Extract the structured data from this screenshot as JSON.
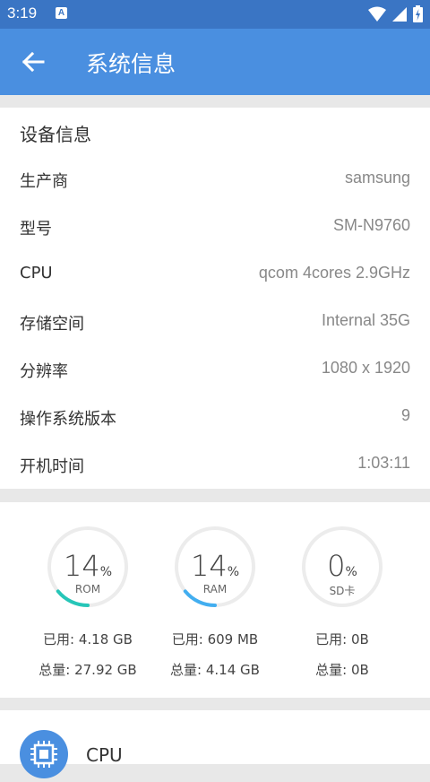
{
  "status_bar": {
    "time": "3:19",
    "notification_icon": "A"
  },
  "app_bar": {
    "title": "系统信息",
    "back_icon": "arrow-left-icon"
  },
  "device_info": {
    "title": "设备信息",
    "rows": [
      {
        "label": "生产商",
        "value": "samsung"
      },
      {
        "label": "型号",
        "value": "SM-N9760"
      },
      {
        "label": "CPU",
        "value": "qcom 4cores 2.9GHz"
      },
      {
        "label": "存储空间",
        "value": "Internal 35G"
      },
      {
        "label": "分辨率",
        "value": "1080 x 1920"
      },
      {
        "label": "操作系统版本",
        "value": "9"
      },
      {
        "label": "开机时间",
        "value": "1:03:11"
      }
    ]
  },
  "storage": {
    "gauges": [
      {
        "name": "ROM",
        "percent": 14,
        "unit": "%",
        "used": "已用: 4.18 GB",
        "total": "总量: 27.92 GB",
        "color": "#26c6b8"
      },
      {
        "name": "RAM",
        "percent": 14,
        "unit": "%",
        "used": "已用: 609 MB",
        "total": "总量: 4.14 GB",
        "color": "#42aef0"
      },
      {
        "name": "SD卡",
        "percent": 0,
        "unit": "%",
        "used": "已用: 0B",
        "total": "总量: 0B",
        "color": "#42aef0"
      }
    ]
  },
  "cpu_section": {
    "label": "CPU",
    "icon": "chip-icon"
  },
  "colors": {
    "status_bar": "#3a75c4",
    "app_bar": "#4a8fe0",
    "track": "#ececec"
  }
}
